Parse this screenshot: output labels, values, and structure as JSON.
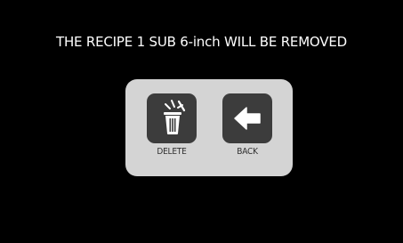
{
  "message": "THE RECIPE 1  SUB 6-inch WILL BE REMOVED",
  "dialog": {
    "delete_label": "DELETE",
    "back_label": "BACK"
  },
  "icons": {
    "delete": "trash-icon",
    "back": "arrow-left-icon"
  },
  "colors": {
    "background": "#000000",
    "text": "#ffffff",
    "panel": "#d4d4d4",
    "button": "#3c3c3c",
    "label": "#2f2f2f"
  }
}
